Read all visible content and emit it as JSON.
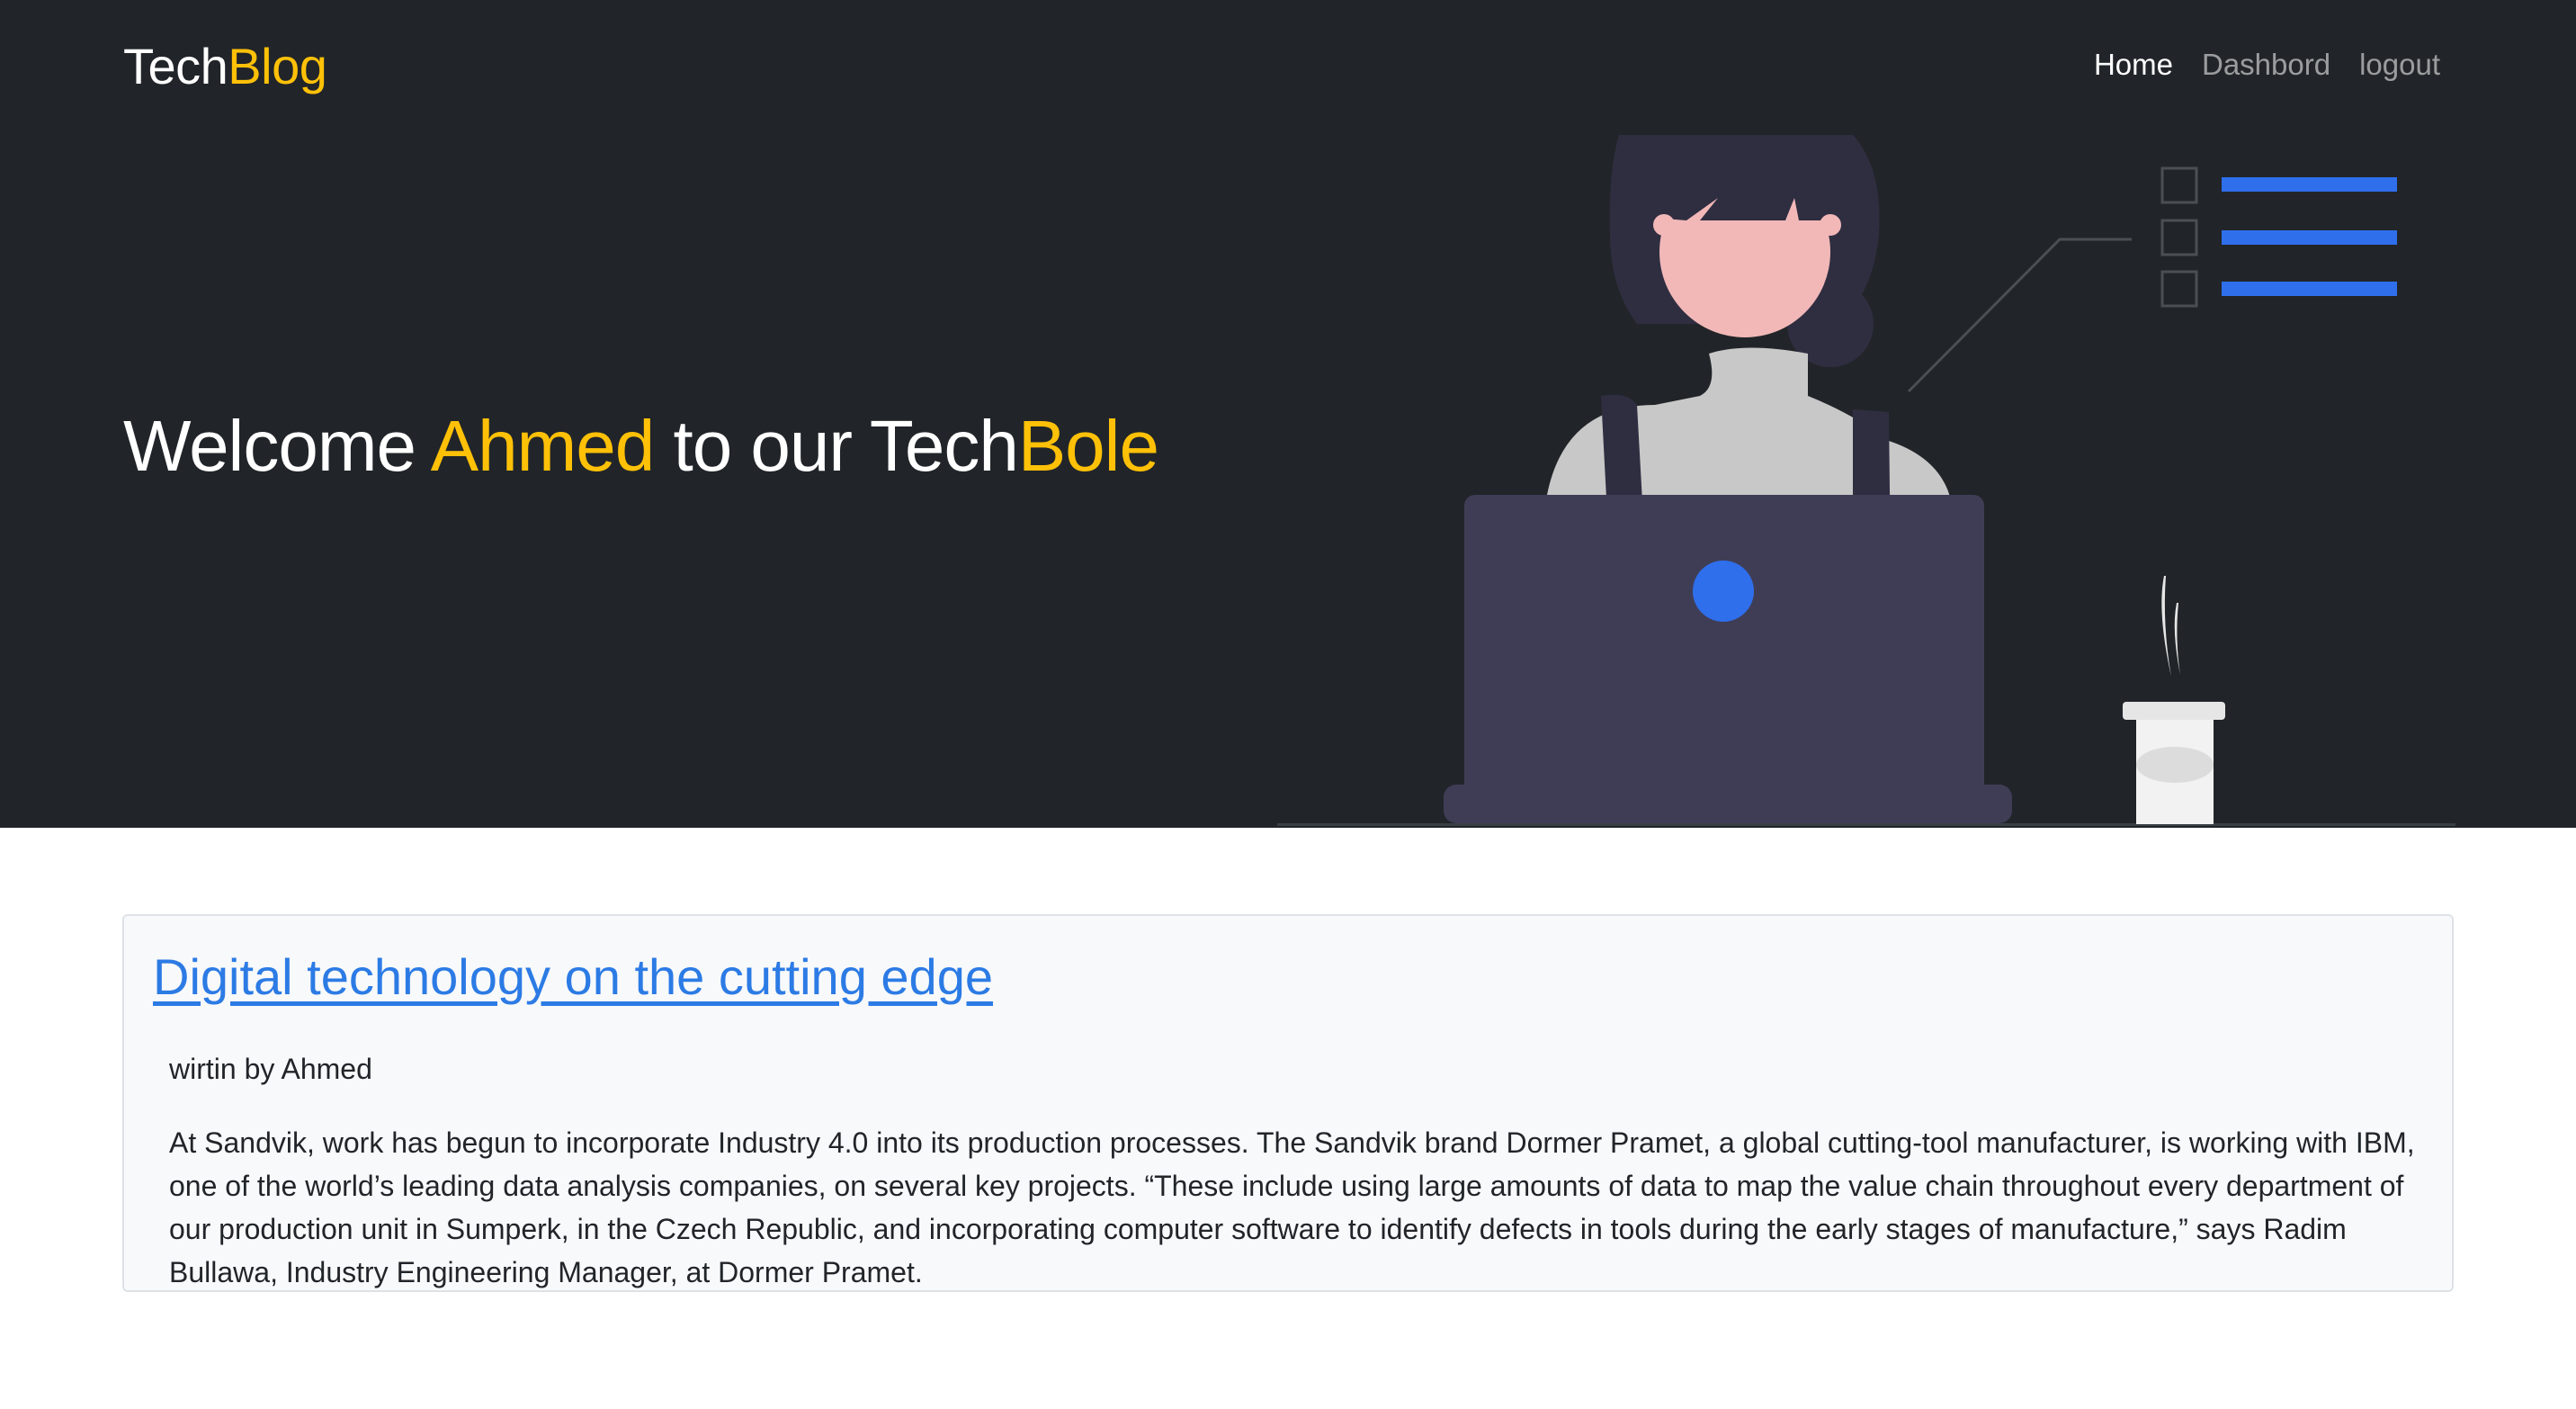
{
  "navbar": {
    "brand_main": "Tech",
    "brand_accent": "Blog",
    "links": [
      {
        "label": "Home",
        "active": true
      },
      {
        "label": "Dashbord",
        "active": false
      },
      {
        "label": "logout",
        "active": false
      }
    ]
  },
  "hero": {
    "welcome": "Welcome ",
    "user": "Ahmed",
    "middle": " to our Tech",
    "accent_end": "Bole",
    "illustration": "woman-working-on-laptop-illustration"
  },
  "post": {
    "title": "Digital technology on the cutting edge",
    "byline": "wirtin by Ahmed",
    "body": "At Sandvik, work has begun to incorporate Industry 4.0 into its production processes. The Sandvik brand Dormer Pramet, a global cutting-tool manufacturer, is working with IBM, one of the world’s leading data analysis companies, on several key projects. “These include using large amounts of data to map the value chain throughout every department of our production unit in Sumperk, in the Czech Republic, and incorporating computer software to identify defects in tools during the early stages of manufacture,” says Radim Bullawa, Industry Engineering Manager, at Dormer Pramet."
  },
  "colors": {
    "dark_bg": "#212529",
    "accent": "#ffc107",
    "link": "#2c7be5",
    "illustration_blue": "#2f6fec",
    "laptop": "#3f3d56",
    "skin": "#f2b8b8"
  }
}
